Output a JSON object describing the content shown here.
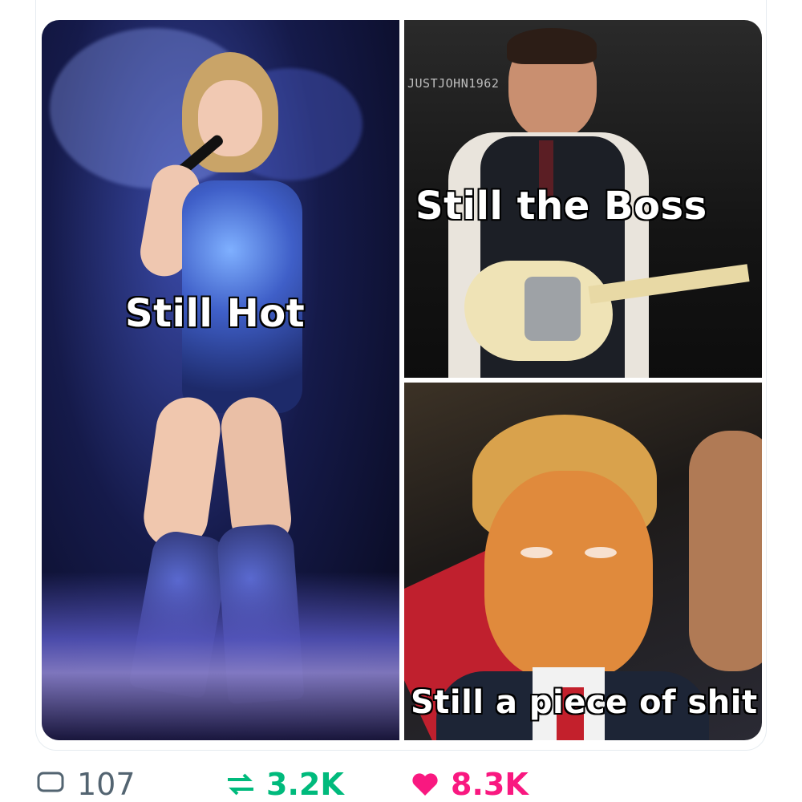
{
  "post": {
    "image": {
      "panels": [
        {
          "caption": "Still Hot"
        },
        {
          "caption": "Still the Boss",
          "watermark": "JUSTJOHN1962"
        },
        {
          "caption": "Still a piece of shit"
        }
      ]
    },
    "actions": {
      "replies": "107",
      "retweets": "3.2K",
      "likes": "8.3K"
    }
  },
  "colors": {
    "retweet": "#00ba7c",
    "like": "#f91880",
    "muted": "#536471"
  },
  "icons": [
    "reply-icon",
    "retweet-icon",
    "like-icon"
  ]
}
